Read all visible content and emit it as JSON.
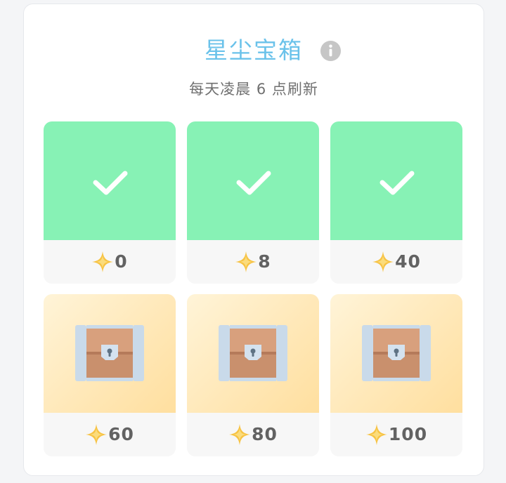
{
  "header": {
    "title": "星尘宝箱",
    "subtitle": "每天凌晨 6 点刷新"
  },
  "icons": {
    "info": "info-icon",
    "star": "sparkle-star-icon",
    "check": "check-icon",
    "chest": "treasure-chest-icon"
  },
  "colors": {
    "title": "#6ac2ea",
    "claimed": "#87f2b5",
    "locked_gradient": [
      "#fff4d8",
      "#ffdf9f"
    ],
    "star": "#f7c344"
  },
  "chests": [
    {
      "amount": "0",
      "state": "claimed"
    },
    {
      "amount": "8",
      "state": "claimed"
    },
    {
      "amount": "40",
      "state": "claimed"
    },
    {
      "amount": "60",
      "state": "locked"
    },
    {
      "amount": "80",
      "state": "locked"
    },
    {
      "amount": "100",
      "state": "locked"
    }
  ]
}
